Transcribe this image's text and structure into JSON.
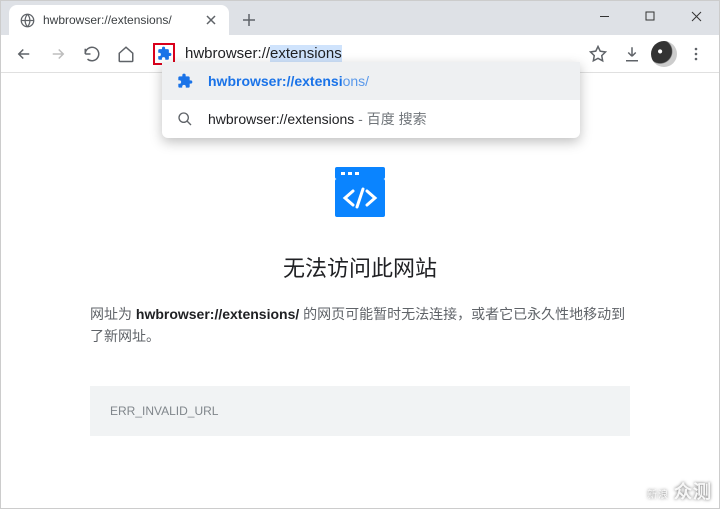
{
  "tab": {
    "title": "hwbrowser://extensions/"
  },
  "addressbar": {
    "typed": "hwbrowser://",
    "completion": "extensions",
    "full": "hwbrowser://extensions"
  },
  "suggestions": [
    {
      "kind": "extension",
      "text_main": "hwbrowser://extensi",
      "text_tail": "ons/",
      "selected": true
    },
    {
      "kind": "search",
      "text_main": "hwbrowser://extensions",
      "text_tail": " - 百度 搜索",
      "selected": false
    }
  ],
  "error": {
    "title": "无法访问此网站",
    "prefix": "网址为 ",
    "url": "hwbrowser://extensions/",
    "suffix": " 的网页可能暂时无法连接，或者它已永久性地移动到了新网址。",
    "code": "ERR_INVALID_URL"
  },
  "watermark": {
    "line1": "新浪",
    "line2": "众测",
    "line3": "· · · · ·"
  }
}
